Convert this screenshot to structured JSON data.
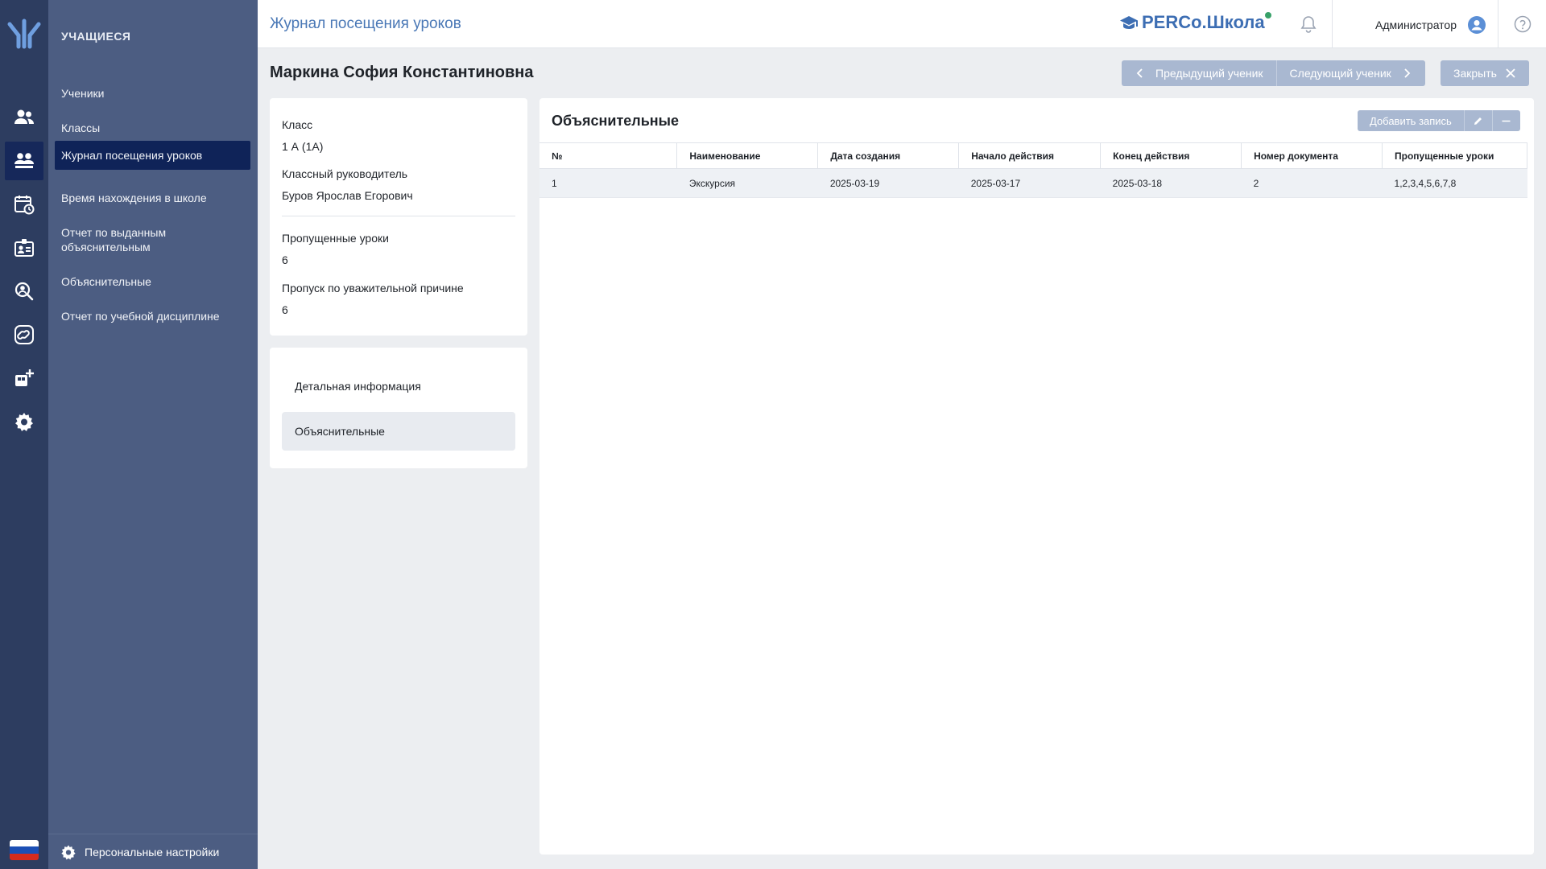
{
  "app": {
    "title": "Журнал посещения уроков",
    "brand": "PERCo.Школа",
    "user": "Администратор"
  },
  "sidebar": {
    "section_title": "УЧАЩИЕСЯ",
    "items": [
      {
        "label": "Ученики"
      },
      {
        "label": "Классы"
      },
      {
        "label": "Журнал посещения уроков"
      },
      {
        "label": "Время нахождения в школе"
      },
      {
        "label": "Отчет по выданным объяснительным"
      },
      {
        "label": "Объяснительные"
      },
      {
        "label": "Отчет по учебной дисциплине"
      }
    ],
    "personal_settings": "Персональные настройки"
  },
  "rail": {
    "icons": [
      "users-icon",
      "students-icon",
      "calendar-clock-icon",
      "badge-icon",
      "search-user-icon",
      "link-icon",
      "add-device-icon",
      "gear-icon"
    ]
  },
  "student": {
    "name": "Маркина София Константиновна",
    "prev_label": "Предыдущий ученик",
    "next_label": "Следующий ученик",
    "close_label": "Закрыть"
  },
  "info": {
    "class_label": "Класс",
    "class_value": "1 А (1А)",
    "teacher_label": "Классный руководитель",
    "teacher_value": "Буров Ярослав Егорович",
    "missed_label": "Пропущенные уроки",
    "missed_value": "6",
    "excused_label": "Пропуск по уважительной причине",
    "excused_value": "6"
  },
  "nav": {
    "items": [
      {
        "label": "Детальная информация"
      },
      {
        "label": "Объяснительные"
      }
    ]
  },
  "main": {
    "title": "Объяснительные",
    "add_label": "Добавить запись",
    "columns": [
      "№",
      "Наименование",
      "Дата создания",
      "Начало действия",
      "Конец действия",
      "Номер документа",
      "Пропущенные уроки"
    ],
    "rows": [
      [
        "1",
        "Экскурсия",
        "2025-03-19",
        "2025-03-17",
        "2025-03-18",
        "2",
        "1,2,3,4,5,6,7,8"
      ]
    ]
  },
  "colors": {
    "rail": "#2d3d60",
    "sidebar": "#4c5d82",
    "active_menu": "#0f2358",
    "accent": "#4a78b6",
    "button": "#a9b8d1"
  }
}
